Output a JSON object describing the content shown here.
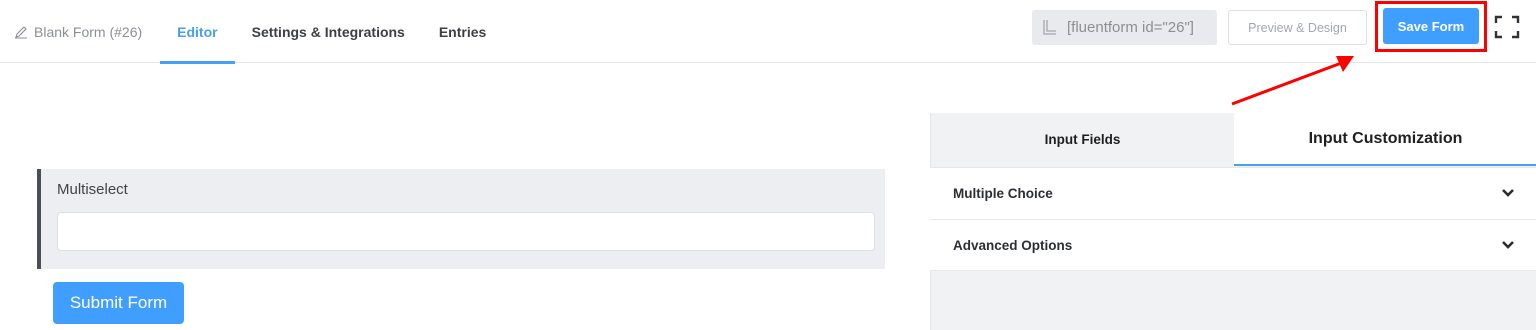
{
  "header": {
    "form_title": "Blank Form (#26)",
    "tabs": [
      {
        "label": "Editor",
        "active": true
      },
      {
        "label": "Settings & Integrations",
        "active": false
      },
      {
        "label": "Entries",
        "active": false
      }
    ],
    "shortcode": "[fluentform id=\"26\"]",
    "preview_label": "Preview & Design",
    "save_label": "Save Form"
  },
  "form": {
    "field_label": "Multiselect",
    "submit_label": "Submit Form"
  },
  "panel": {
    "tabs": [
      {
        "label": "Input Fields",
        "active": false
      },
      {
        "label": "Input Customization",
        "active": true
      }
    ],
    "sections": [
      {
        "label": "Multiple Choice"
      },
      {
        "label": "Advanced Options"
      }
    ]
  },
  "colors": {
    "accent": "#409eff",
    "highlight": "#ff0000"
  }
}
